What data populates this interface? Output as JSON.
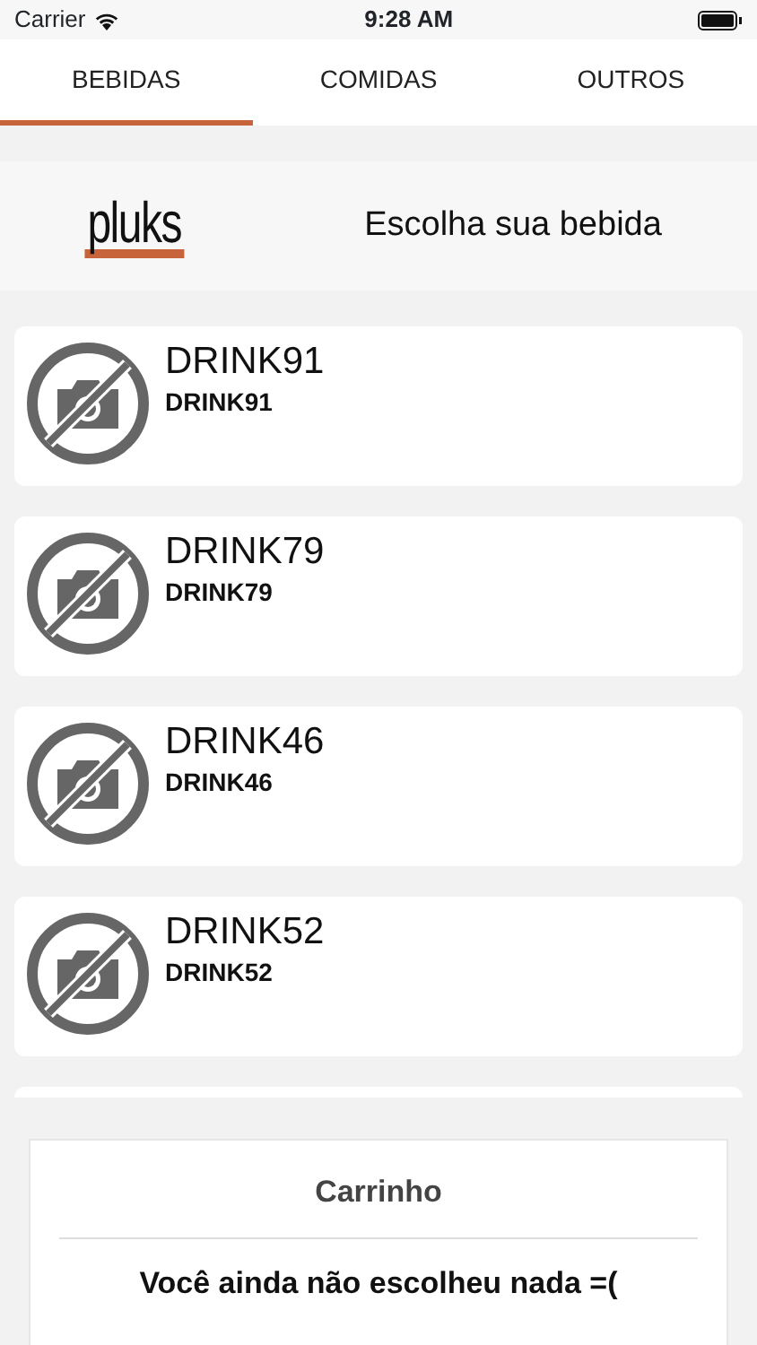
{
  "status_bar": {
    "carrier": "Carrier",
    "time": "9:28 AM"
  },
  "tabs": [
    {
      "label": "BEBIDAS",
      "selected": true
    },
    {
      "label": "COMIDAS",
      "selected": false
    },
    {
      "label": "OUTROS",
      "selected": false
    }
  ],
  "header": {
    "logo": "pluks",
    "title": "Escolha sua bebida"
  },
  "products": [
    {
      "name": "DRINK91",
      "subtitle": "DRINK91"
    },
    {
      "name": "DRINK79",
      "subtitle": "DRINK79"
    },
    {
      "name": "DRINK46",
      "subtitle": "DRINK46"
    },
    {
      "name": "DRINK52",
      "subtitle": "DRINK52"
    },
    {
      "kind": "cut"
    }
  ],
  "cart": {
    "title": "Carrinho",
    "message": "Você ainda não escolheu nada =("
  }
}
